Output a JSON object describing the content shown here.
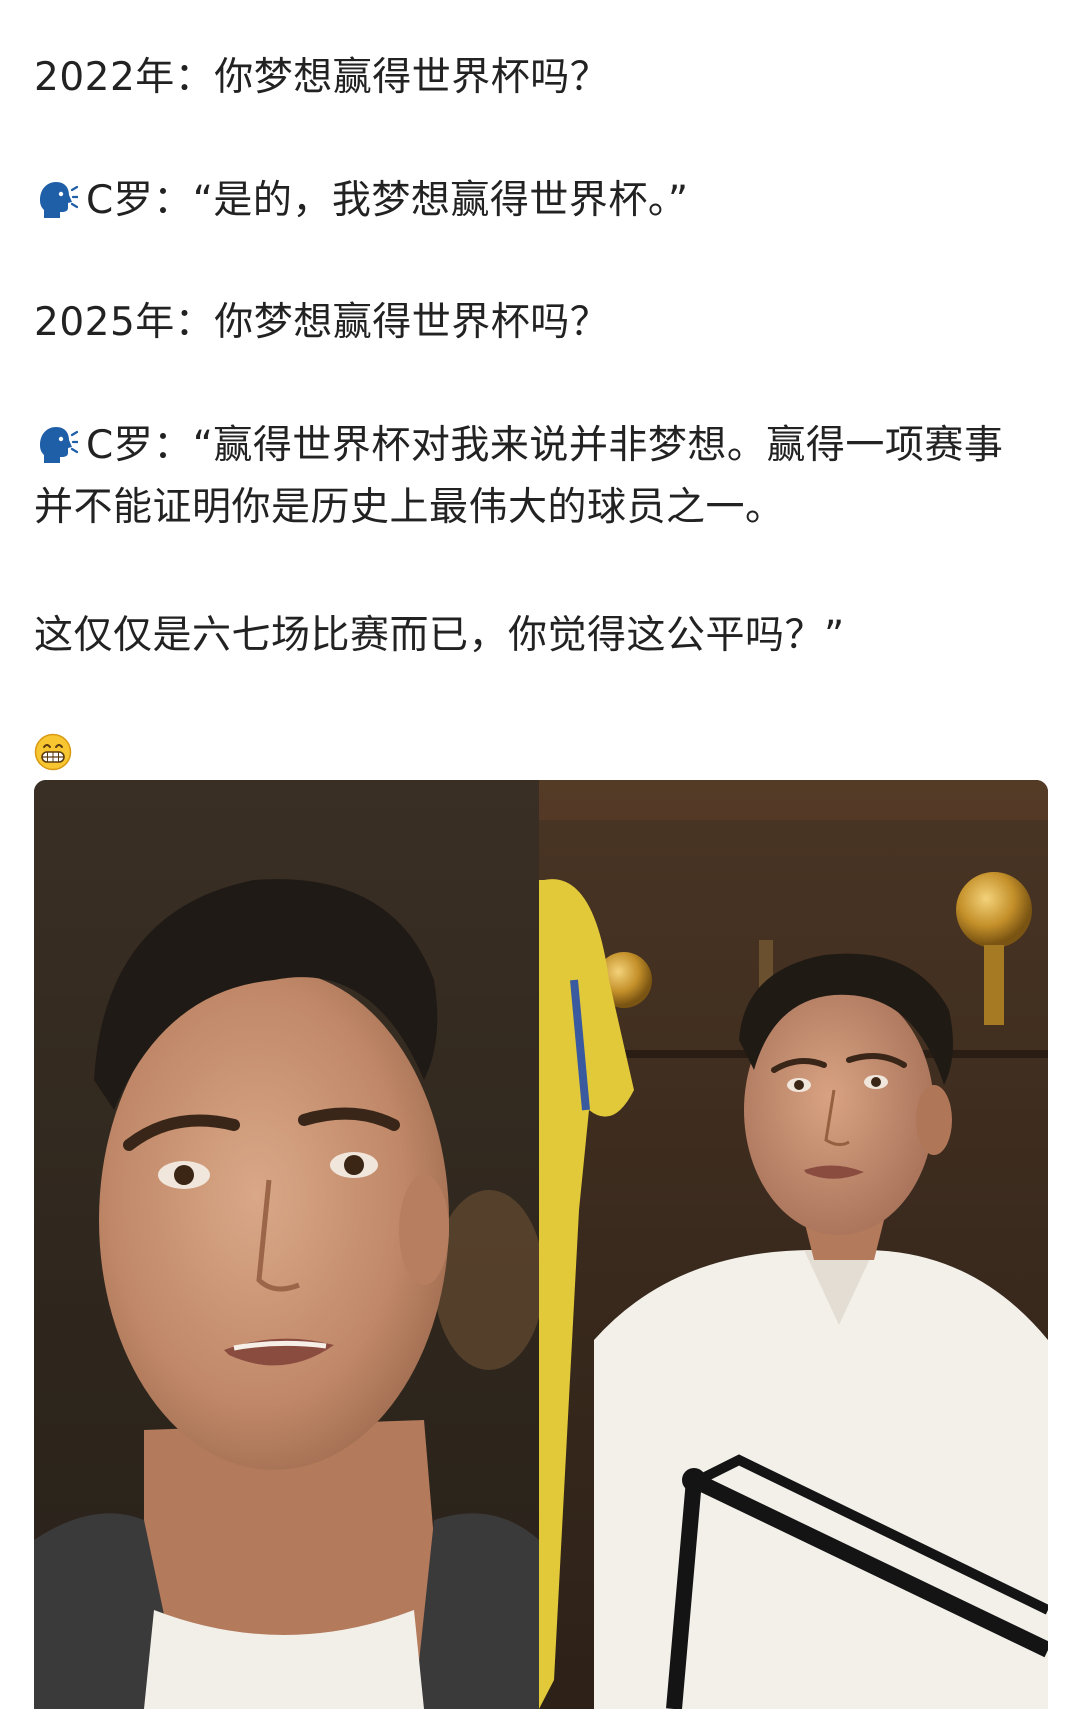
{
  "post": {
    "lines": [
      "2022年：你梦想赢得世界杯吗？",
      "C罗：“是的，我梦想赢得世界杯。”",
      "2025年：你梦想赢得世界杯吗？",
      "C罗：“赢得世界杯对我来说并非梦想。赢得一项赛事并不能证明你是历史上最伟大的球员之一。",
      "这仅仅是六七场比赛而已，你觉得这公平吗？”"
    ],
    "icons": {
      "speaker": "speaking-head-icon",
      "reaction": "grinning-face-icon"
    }
  },
  "colors": {
    "text": "#222222",
    "speaker_blue": "#1f5fa8",
    "emoji_yellow": "#f7c631"
  }
}
